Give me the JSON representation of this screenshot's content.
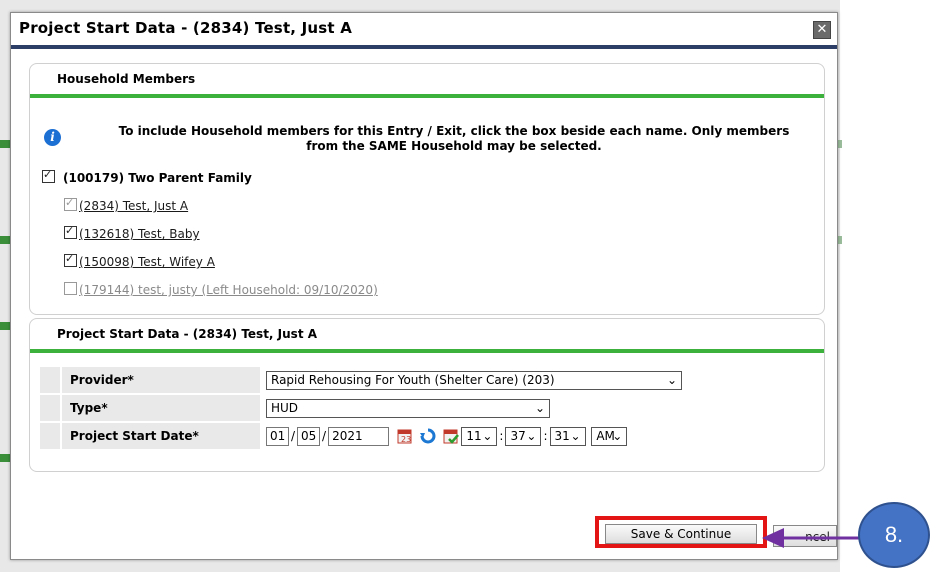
{
  "dialog": {
    "title": "Project Start Data - (2834) Test, Just A",
    "close_icon": "close-icon"
  },
  "household": {
    "header": "Household Members",
    "info_text": "To include Household members for this Entry / Exit, click the box beside each name. Only members from the SAME Household may be selected.",
    "family": {
      "label": "(100179) Two Parent Family",
      "checked": true
    },
    "members": [
      {
        "label": "(2834) Test, Just A",
        "checked": true,
        "disabled": true
      },
      {
        "label": "(132618) Test, Baby",
        "checked": true,
        "disabled": false
      },
      {
        "label": "(150098) Test, Wifey A",
        "checked": true,
        "disabled": false
      },
      {
        "label": "(179144) test, justy (Left Household: 09/10/2020)",
        "checked": false,
        "disabled": true
      }
    ]
  },
  "start_data": {
    "header": "Project Start Data - (2834) Test, Just A",
    "provider_label": "Provider",
    "provider_value": "Rapid Rehousing For Youth (Shelter Care) (203)",
    "type_label": "Type",
    "type_value": "HUD",
    "date_label": "Project Start Date",
    "required_marker": "*",
    "month": "01",
    "day": "05",
    "year": "2021",
    "hour": "11",
    "minute": "37",
    "second": "31",
    "ampm": "AM",
    "date_sep": "/",
    "time_sep": ":"
  },
  "buttons": {
    "save_label": "Save & Continue",
    "cancel_label": "ncel"
  },
  "callout": {
    "step_label": "8."
  },
  "colors": {
    "accent_green": "#3cb23c",
    "title_border": "#2c3e66",
    "highlight_red": "#e31515",
    "callout_blue": "#4472c4",
    "arrow_purple": "#7030a0"
  }
}
